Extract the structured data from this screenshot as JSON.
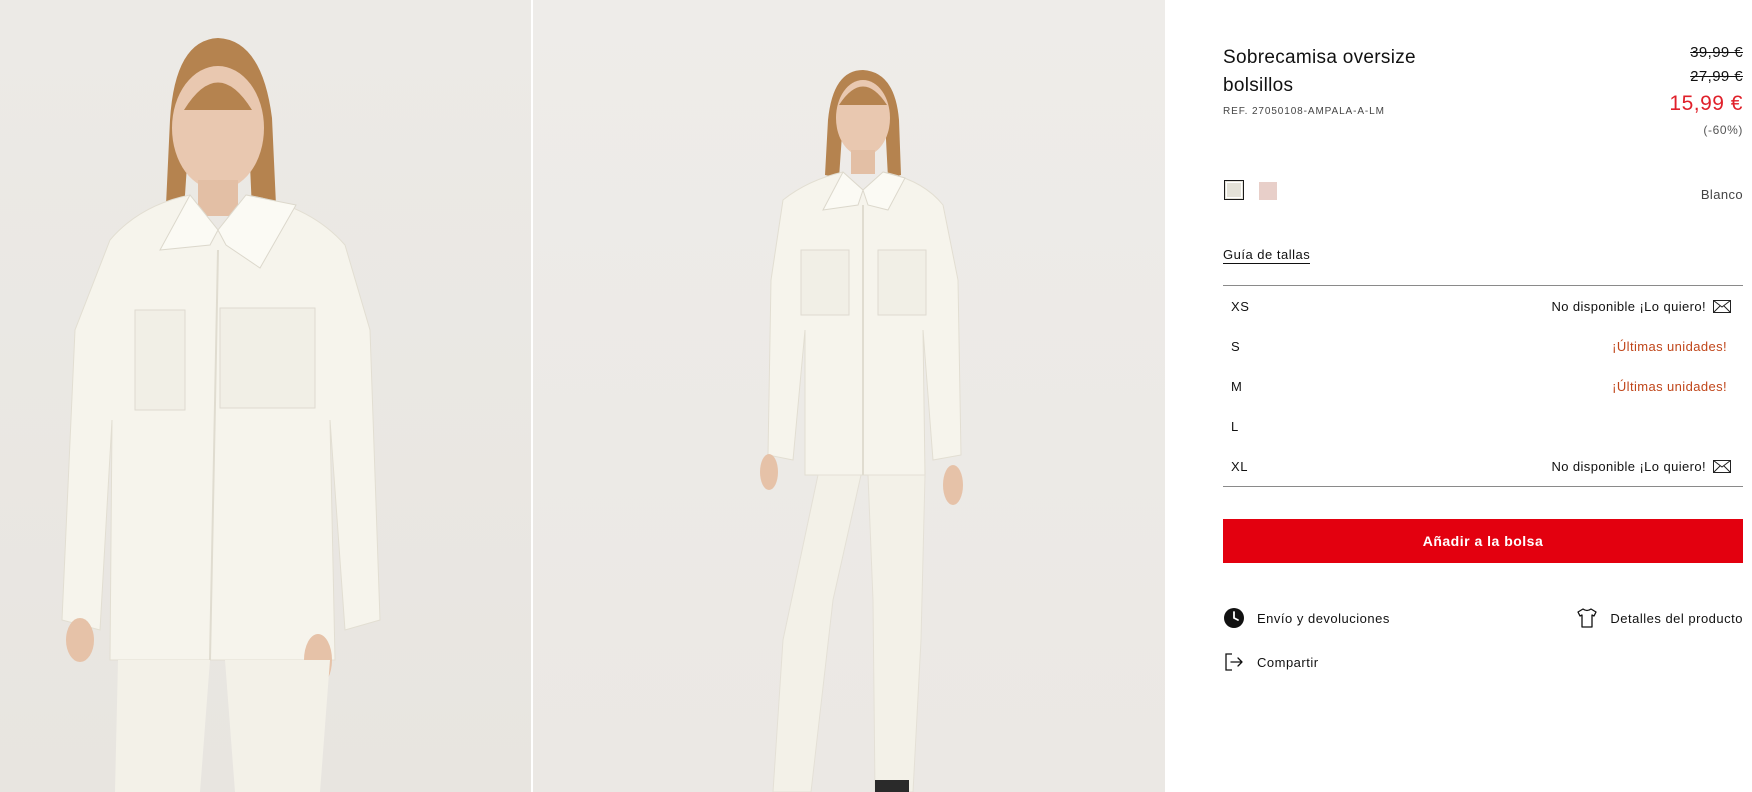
{
  "product": {
    "title": "Sobrecamisa oversize bolsillos",
    "reference": "REF. 27050108-AMPALA-A-LM",
    "price_original": "39,99 €",
    "price_previous": "27,99 €",
    "price_current": "15,99 €",
    "discount": "(-60%)",
    "selected_color": "Blanco",
    "colors": [
      {
        "name": "Blanco",
        "hex": "#e4e2d8"
      },
      {
        "name": "pink",
        "hex": "#e8cfc9"
      }
    ]
  },
  "size_guide_label": "Guía de tallas",
  "sizes": [
    {
      "label": "XS",
      "status": "No disponible ¡Lo quiero!",
      "icon": "mail-icon"
    },
    {
      "label": "S",
      "status": "¡Últimas unidades!"
    },
    {
      "label": "M",
      "status": "¡Últimas unidades!"
    },
    {
      "label": "L",
      "status": ""
    },
    {
      "label": "XL",
      "status": "No disponible ¡Lo quiero!",
      "icon": "mail-icon"
    }
  ],
  "add_to_bag_label": "Añadir a la bolsa",
  "links": {
    "shipping": "Envío y devoluciones",
    "details": "Detalles del producto",
    "share": "Compartir"
  },
  "colors": {
    "accent_red": "#e3000f",
    "sale_red": "#e0202a",
    "warning_orange": "#c0461a"
  }
}
